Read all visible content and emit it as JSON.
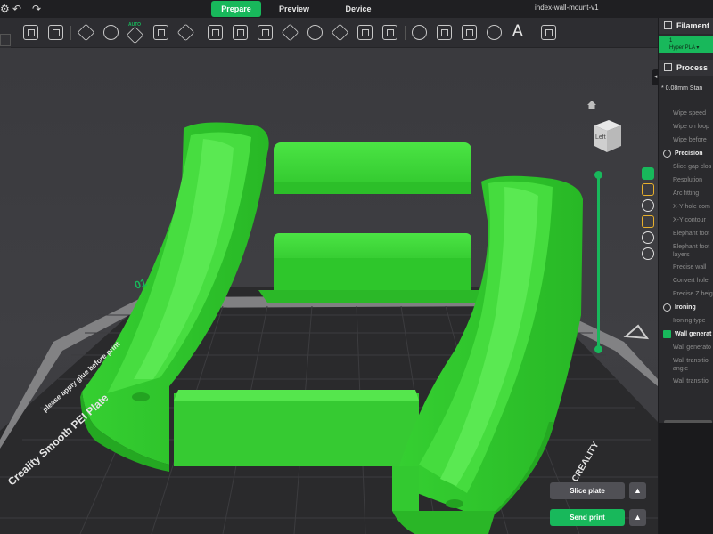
{
  "titlebar": {
    "tabs": [
      "Prepare",
      "Preview",
      "Device"
    ],
    "project_name": "index-wall-mount-v1"
  },
  "toolbar": {
    "auto_label": "AUTO",
    "text_tool_label": "A"
  },
  "viewport": {
    "view_cube_label": "Left",
    "plate_number": "01",
    "plate_name": "Creality Smooth PEI Plate",
    "plate_note": "please apply glue before print",
    "plate_brand": "CREALITY",
    "model_color": "#3ed63a"
  },
  "actions": {
    "slice_label": "Slice plate",
    "send_label": "Send print",
    "arrow_up": "▲"
  },
  "right_panel": {
    "filament_title": "Filament",
    "filament_slot": "1",
    "filament_name": "Hyper PLA ▾",
    "process_title": "Process",
    "preset": "* 0.08mm Stan",
    "items": [
      {
        "type": "item",
        "label": "Wipe speed"
      },
      {
        "type": "item",
        "label": "Wipe on loop"
      },
      {
        "type": "item",
        "label": "Wipe before"
      },
      {
        "type": "group",
        "label": "Precision"
      },
      {
        "type": "item",
        "label": "Slice gap clos"
      },
      {
        "type": "item",
        "label": "Resolution"
      },
      {
        "type": "item",
        "label": "Arc fitting"
      },
      {
        "type": "item",
        "label": "X-Y hole com"
      },
      {
        "type": "item",
        "label": "X-Y contour"
      },
      {
        "type": "item",
        "label": "Elephant foot"
      },
      {
        "type": "item",
        "label": "Elephant foot layers"
      },
      {
        "type": "item",
        "label": "Precise wall"
      },
      {
        "type": "item",
        "label": "Convert hole"
      },
      {
        "type": "item",
        "label": "Precise Z heig"
      },
      {
        "type": "group",
        "label": "Ironing"
      },
      {
        "type": "item",
        "label": "Ironing type"
      },
      {
        "type": "group",
        "label": "Wall generat"
      },
      {
        "type": "item",
        "label": "Wall generato"
      },
      {
        "type": "item",
        "label": "Wall transitio angle"
      },
      {
        "type": "item",
        "label": "Wall transitio"
      }
    ]
  },
  "colors": {
    "accent": "#18b85b",
    "model": "#3ed63a",
    "plate": "#2a2a2c"
  }
}
